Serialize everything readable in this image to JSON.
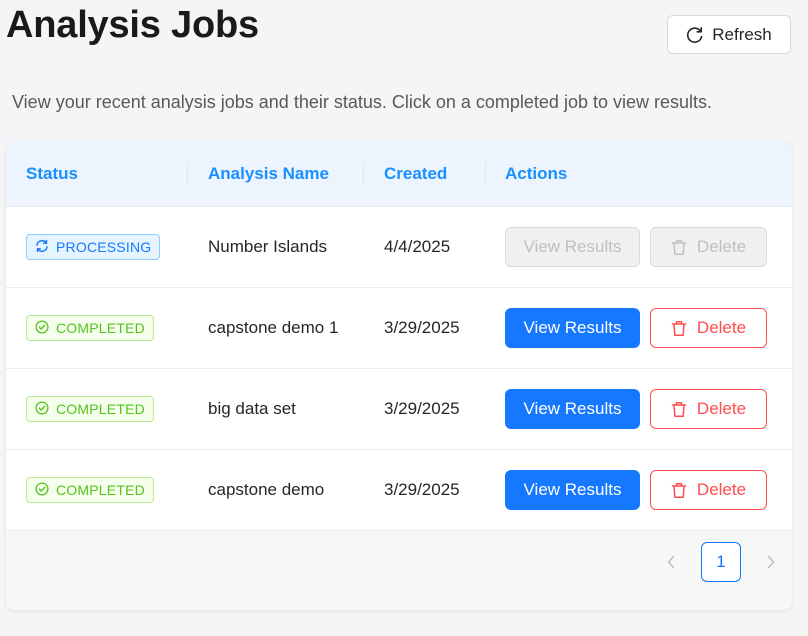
{
  "header": {
    "title": "Analysis Jobs",
    "refresh_label": "Refresh",
    "subtitle": "View your recent analysis jobs and their status. Click on a completed job to view results."
  },
  "table": {
    "columns": [
      "Status",
      "Analysis Name",
      "Created",
      "Actions"
    ],
    "rows": [
      {
        "status": "PROCESSING",
        "status_icon": "sync-icon",
        "name": "Number Islands",
        "created": "4/4/2025",
        "view_label": "View Results",
        "delete_label": "Delete",
        "actions_enabled": false
      },
      {
        "status": "COMPLETED",
        "status_icon": "check-circle-icon",
        "name": "capstone demo 1",
        "created": "3/29/2025",
        "view_label": "View Results",
        "delete_label": "Delete",
        "actions_enabled": true
      },
      {
        "status": "COMPLETED",
        "status_icon": "check-circle-icon",
        "name": "big data set",
        "created": "3/29/2025",
        "view_label": "View Results",
        "delete_label": "Delete",
        "actions_enabled": true
      },
      {
        "status": "COMPLETED",
        "status_icon": "check-circle-icon",
        "name": "capstone demo",
        "created": "3/29/2025",
        "view_label": "View Results",
        "delete_label": "Delete",
        "actions_enabled": true
      }
    ]
  },
  "pagination": {
    "current_page": "1",
    "prev_icon": "chevron-left-icon",
    "next_icon": "chevron-right-icon"
  },
  "colors": {
    "primary": "#1677ff",
    "danger": "#ff4d4f",
    "success": "#52c41a",
    "header_bg": "#eef4fd"
  }
}
